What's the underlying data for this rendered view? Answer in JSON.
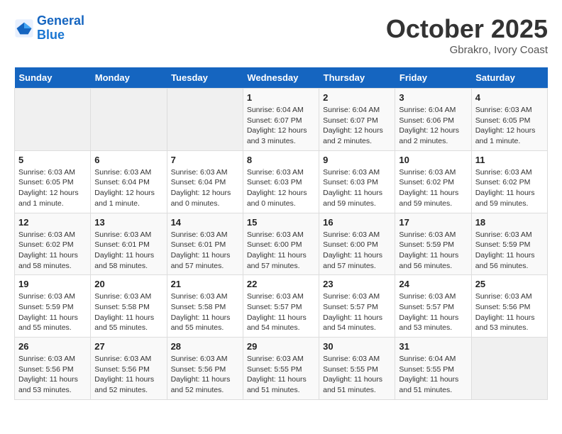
{
  "header": {
    "logo_line1": "General",
    "logo_line2": "Blue",
    "month_title": "October 2025",
    "location": "Gbrakro, Ivory Coast"
  },
  "weekdays": [
    "Sunday",
    "Monday",
    "Tuesday",
    "Wednesday",
    "Thursday",
    "Friday",
    "Saturday"
  ],
  "weeks": [
    [
      {
        "day": "",
        "info": ""
      },
      {
        "day": "",
        "info": ""
      },
      {
        "day": "",
        "info": ""
      },
      {
        "day": "1",
        "info": "Sunrise: 6:04 AM\nSunset: 6:07 PM\nDaylight: 12 hours and 3 minutes."
      },
      {
        "day": "2",
        "info": "Sunrise: 6:04 AM\nSunset: 6:07 PM\nDaylight: 12 hours and 2 minutes."
      },
      {
        "day": "3",
        "info": "Sunrise: 6:04 AM\nSunset: 6:06 PM\nDaylight: 12 hours and 2 minutes."
      },
      {
        "day": "4",
        "info": "Sunrise: 6:03 AM\nSunset: 6:05 PM\nDaylight: 12 hours and 1 minute."
      }
    ],
    [
      {
        "day": "5",
        "info": "Sunrise: 6:03 AM\nSunset: 6:05 PM\nDaylight: 12 hours and 1 minute."
      },
      {
        "day": "6",
        "info": "Sunrise: 6:03 AM\nSunset: 6:04 PM\nDaylight: 12 hours and 1 minute."
      },
      {
        "day": "7",
        "info": "Sunrise: 6:03 AM\nSunset: 6:04 PM\nDaylight: 12 hours and 0 minutes."
      },
      {
        "day": "8",
        "info": "Sunrise: 6:03 AM\nSunset: 6:03 PM\nDaylight: 12 hours and 0 minutes."
      },
      {
        "day": "9",
        "info": "Sunrise: 6:03 AM\nSunset: 6:03 PM\nDaylight: 11 hours and 59 minutes."
      },
      {
        "day": "10",
        "info": "Sunrise: 6:03 AM\nSunset: 6:02 PM\nDaylight: 11 hours and 59 minutes."
      },
      {
        "day": "11",
        "info": "Sunrise: 6:03 AM\nSunset: 6:02 PM\nDaylight: 11 hours and 59 minutes."
      }
    ],
    [
      {
        "day": "12",
        "info": "Sunrise: 6:03 AM\nSunset: 6:02 PM\nDaylight: 11 hours and 58 minutes."
      },
      {
        "day": "13",
        "info": "Sunrise: 6:03 AM\nSunset: 6:01 PM\nDaylight: 11 hours and 58 minutes."
      },
      {
        "day": "14",
        "info": "Sunrise: 6:03 AM\nSunset: 6:01 PM\nDaylight: 11 hours and 57 minutes."
      },
      {
        "day": "15",
        "info": "Sunrise: 6:03 AM\nSunset: 6:00 PM\nDaylight: 11 hours and 57 minutes."
      },
      {
        "day": "16",
        "info": "Sunrise: 6:03 AM\nSunset: 6:00 PM\nDaylight: 11 hours and 57 minutes."
      },
      {
        "day": "17",
        "info": "Sunrise: 6:03 AM\nSunset: 5:59 PM\nDaylight: 11 hours and 56 minutes."
      },
      {
        "day": "18",
        "info": "Sunrise: 6:03 AM\nSunset: 5:59 PM\nDaylight: 11 hours and 56 minutes."
      }
    ],
    [
      {
        "day": "19",
        "info": "Sunrise: 6:03 AM\nSunset: 5:59 PM\nDaylight: 11 hours and 55 minutes."
      },
      {
        "day": "20",
        "info": "Sunrise: 6:03 AM\nSunset: 5:58 PM\nDaylight: 11 hours and 55 minutes."
      },
      {
        "day": "21",
        "info": "Sunrise: 6:03 AM\nSunset: 5:58 PM\nDaylight: 11 hours and 55 minutes."
      },
      {
        "day": "22",
        "info": "Sunrise: 6:03 AM\nSunset: 5:57 PM\nDaylight: 11 hours and 54 minutes."
      },
      {
        "day": "23",
        "info": "Sunrise: 6:03 AM\nSunset: 5:57 PM\nDaylight: 11 hours and 54 minutes."
      },
      {
        "day": "24",
        "info": "Sunrise: 6:03 AM\nSunset: 5:57 PM\nDaylight: 11 hours and 53 minutes."
      },
      {
        "day": "25",
        "info": "Sunrise: 6:03 AM\nSunset: 5:56 PM\nDaylight: 11 hours and 53 minutes."
      }
    ],
    [
      {
        "day": "26",
        "info": "Sunrise: 6:03 AM\nSunset: 5:56 PM\nDaylight: 11 hours and 53 minutes."
      },
      {
        "day": "27",
        "info": "Sunrise: 6:03 AM\nSunset: 5:56 PM\nDaylight: 11 hours and 52 minutes."
      },
      {
        "day": "28",
        "info": "Sunrise: 6:03 AM\nSunset: 5:56 PM\nDaylight: 11 hours and 52 minutes."
      },
      {
        "day": "29",
        "info": "Sunrise: 6:03 AM\nSunset: 5:55 PM\nDaylight: 11 hours and 51 minutes."
      },
      {
        "day": "30",
        "info": "Sunrise: 6:03 AM\nSunset: 5:55 PM\nDaylight: 11 hours and 51 minutes."
      },
      {
        "day": "31",
        "info": "Sunrise: 6:04 AM\nSunset: 5:55 PM\nDaylight: 11 hours and 51 minutes."
      },
      {
        "day": "",
        "info": ""
      }
    ]
  ]
}
